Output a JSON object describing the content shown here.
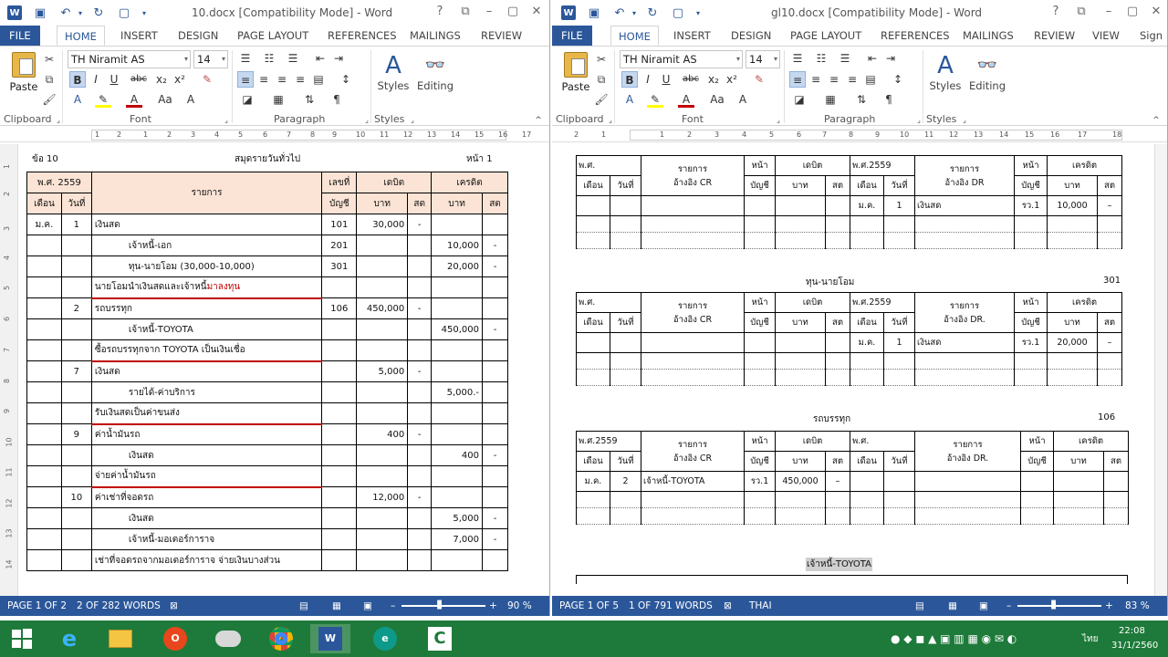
{
  "left": {
    "title": "10.docx [Compatibility Mode] - Word",
    "tabs": [
      "FILE",
      "HOME",
      "INSERT",
      "DESIGN",
      "PAGE LAYOUT",
      "REFERENCES",
      "MAILINGS",
      "REVIEW"
    ],
    "font": "TH Niramit AS",
    "size": "14",
    "groups": {
      "clipboard": "Clipboard",
      "font": "Font",
      "paragraph": "Paragraph",
      "styles": "Styles"
    },
    "paste": "Paste",
    "styles_btn": "Styles",
    "editing_btn": "Editing",
    "ruler": [
      "1",
      "2",
      "1",
      "2",
      "3",
      "4",
      "5",
      "6",
      "7",
      "8",
      "9",
      "10",
      "11",
      "12",
      "13",
      "14",
      "15",
      "16",
      "17"
    ],
    "vruler": [
      "1",
      "2",
      "3",
      "4",
      "5",
      "6",
      "7",
      "8",
      "9",
      "10",
      "11",
      "12",
      "13",
      "14"
    ],
    "doc": {
      "item": "ข้อ 10",
      "heading": "สมุดรายวันทั่วไป",
      "page": "หน้า 1",
      "h_year": "พ.ศ. 2559",
      "h_month": "เดือน",
      "h_day": "วันที่",
      "h_desc": "รายการ",
      "h_ref1": "เลขที่",
      "h_ref2": "บัญชี",
      "h_dr": "เดบิต",
      "h_cr": "เครดิต",
      "h_baht": "บาท",
      "h_satang": "สต",
      "rows": [
        {
          "m": "ม.ค.",
          "d": "1",
          "desc": "เงินสด",
          "ref": "101",
          "dr": "30,000",
          "drs": "-",
          "cr": "",
          "crs": "",
          "ind": 0
        },
        {
          "m": "",
          "d": "",
          "desc": "เจ้าหนี้-เอก",
          "ref": "201",
          "dr": "",
          "drs": "",
          "cr": "10,000",
          "crs": "-",
          "ind": 1
        },
        {
          "m": "",
          "d": "",
          "desc": "ทุน-นายโอม (30,000-10,000)",
          "ref": "301",
          "dr": "",
          "drs": "",
          "cr": "20,000",
          "crs": "-",
          "ind": 1
        },
        {
          "m": "",
          "d": "",
          "desc": "นายโอมนำเงินสดและเจ้าหนี้",
          "desc_red": "มาลงทุน",
          "ref": "",
          "dr": "",
          "drs": "",
          "cr": "",
          "crs": "",
          "ind": 0,
          "u": true
        },
        {
          "m": "",
          "d": "2",
          "desc": "รถบรรทุก",
          "ref": "106",
          "dr": "450,000",
          "drs": "-",
          "cr": "",
          "crs": "",
          "ind": 0
        },
        {
          "m": "",
          "d": "",
          "desc": "เจ้าหนี้-TOYOTA",
          "ref": "",
          "dr": "",
          "drs": "",
          "cr": "450,000",
          "crs": "-",
          "ind": 1
        },
        {
          "m": "",
          "d": "",
          "desc": "ซื้อรถบรรทุกจาก TOYOTA เป็นเงินเชื่อ",
          "ref": "",
          "dr": "",
          "drs": "",
          "cr": "",
          "crs": "",
          "ind": 0,
          "u": true
        },
        {
          "m": "",
          "d": "7",
          "desc": "เงินสด",
          "ref": "",
          "dr": "5,000",
          "drs": "-",
          "cr": "",
          "crs": "",
          "ind": 0
        },
        {
          "m": "",
          "d": "",
          "desc": "รายได้-ค่าบริการ",
          "ref": "",
          "dr": "",
          "drs": "",
          "cr": "5,000.-",
          "crs": "",
          "ind": 1
        },
        {
          "m": "",
          "d": "",
          "desc": "รับเงินสดเป็นค่าขนส่ง",
          "ref": "",
          "dr": "",
          "drs": "",
          "cr": "",
          "crs": "",
          "ind": 0,
          "u": true
        },
        {
          "m": "",
          "d": "9",
          "desc": "ค่าน้ำมันรถ",
          "ref": "",
          "dr": "400",
          "drs": "-",
          "cr": "",
          "crs": "",
          "ind": 0
        },
        {
          "m": "",
          "d": "",
          "desc": "เงินสด",
          "ref": "",
          "dr": "",
          "drs": "",
          "cr": "400",
          "crs": "-",
          "ind": 1
        },
        {
          "m": "",
          "d": "",
          "desc": "จ่ายค่าน้ำมันรถ",
          "ref": "",
          "dr": "",
          "drs": "",
          "cr": "",
          "crs": "",
          "ind": 0,
          "u": true
        },
        {
          "m": "",
          "d": "10",
          "desc": "ค่าเช่าที่จอดรถ",
          "ref": "",
          "dr": "12,000",
          "drs": "-",
          "cr": "",
          "crs": "",
          "ind": 0
        },
        {
          "m": "",
          "d": "",
          "desc": "เงินสด",
          "ref": "",
          "dr": "",
          "drs": "",
          "cr": "5,000",
          "crs": "-",
          "ind": 1
        },
        {
          "m": "",
          "d": "",
          "desc": "เจ้าหนี้-มอเตอร์การาจ",
          "ref": "",
          "dr": "",
          "drs": "",
          "cr": "7,000",
          "crs": "-",
          "ind": 1
        },
        {
          "m": "",
          "d": "",
          "desc": "เช่าที่จอดรถจากมอเตอร์การาจ จ่ายเงินบางส่วน",
          "ref": "",
          "dr": "",
          "drs": "",
          "cr": "",
          "crs": "",
          "ind": 0
        }
      ]
    },
    "status": {
      "page": "PAGE 1 OF 2",
      "words": "2 OF 282 WORDS",
      "zoom": "90 %"
    }
  },
  "right": {
    "title": "gl10.docx [Compatibility Mode] - Word",
    "tabs": [
      "FILE",
      "HOME",
      "INSERT",
      "DESIGN",
      "PAGE LAYOUT",
      "REFERENCES",
      "MAILINGS",
      "REVIEW",
      "VIEW",
      "Sign"
    ],
    "font": "TH Niramit AS",
    "size": "14",
    "groups": {
      "clipboard": "Clipboard",
      "font": "Font",
      "paragraph": "Paragraph",
      "styles": "Styles"
    },
    "paste": "Paste",
    "styles_btn": "Styles",
    "editing_btn": "Editing",
    "ruler": [
      "2",
      "1",
      "1",
      "2",
      "3",
      "4",
      "5",
      "6",
      "7",
      "8",
      "9",
      "10",
      "11",
      "12",
      "13",
      "14",
      "15",
      "16",
      "17",
      "18"
    ],
    "h": {
      "ps": "พ.ศ.",
      "ps2559": "พ.ศ.2559",
      "month": "เดือน",
      "day": "วันที่",
      "desc": "รายการ",
      "ref_cr": "อ้างอิง CR",
      "ref_dr": "อ้างอิง DR",
      "ref_dr2": "อ้างอิง DR.",
      "page1": "หน้า",
      "page2": "บัญชี",
      "dr": "เดบิต",
      "cr": "เครดิต",
      "baht": "บาท",
      "satang": "สต"
    },
    "ledger1": {
      "m": "ม.ค.",
      "d": "1",
      "desc": "เงินสด",
      "ref": "รว.1",
      "amt": "10,000",
      "s": "–"
    },
    "ledger2": {
      "name": "ทุน-นายโอม",
      "no": "301",
      "m": "ม.ค.",
      "d": "1",
      "desc": "เงินสด",
      "ref": "รว.1",
      "amt": "20,000",
      "s": "–"
    },
    "ledger3": {
      "name": "รถบรรทุก",
      "no": "106",
      "m": "ม.ค.",
      "d": "2",
      "desc": "เจ้าหนี้-TOYOTA",
      "ref": "รว.1",
      "amt": "450,000",
      "s": "–"
    },
    "ledger4": {
      "name": "เจ้าหนี้-TOYOTA"
    },
    "status": {
      "page": "PAGE 1 OF 5",
      "words": "1 OF 791 WORDS",
      "lang": "THAI",
      "zoom": "83 %"
    }
  },
  "tray": {
    "lang": "ไทย",
    "time": "22:08",
    "date": "31/1/2560"
  }
}
